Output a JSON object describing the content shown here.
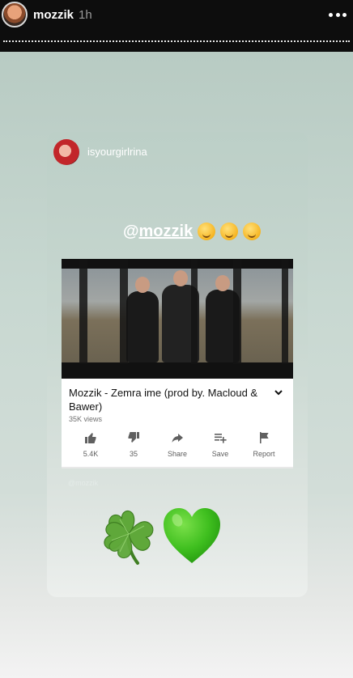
{
  "header": {
    "username": "mozzik",
    "time": "1h"
  },
  "sticker": {
    "username": "isyourgirlrina"
  },
  "mention": {
    "at": "@",
    "handle": "mozzik"
  },
  "video": {
    "title": "Mozzik - Zemra ime (prod by. Macloud & Bawer)",
    "views": "35K views",
    "actions": {
      "like": "5.4K",
      "dislike": "35",
      "share": "Share",
      "save": "Save",
      "report": "Report"
    }
  },
  "watermark": "@mozzik",
  "colors": {
    "story_bg": "#c8d8d1",
    "heart": "#3fbf1f",
    "clover": "#5fa83a"
  },
  "icons": {
    "more": "more-dots-icon",
    "like": "thumbs-up-icon",
    "dislike": "thumbs-down-icon",
    "share": "share-arrow-icon",
    "save": "playlist-add-icon",
    "report": "flag-icon",
    "chevron": "chevron-down-icon",
    "clover": "four-leaf-clover-emoji",
    "heart": "green-heart-emoji"
  }
}
